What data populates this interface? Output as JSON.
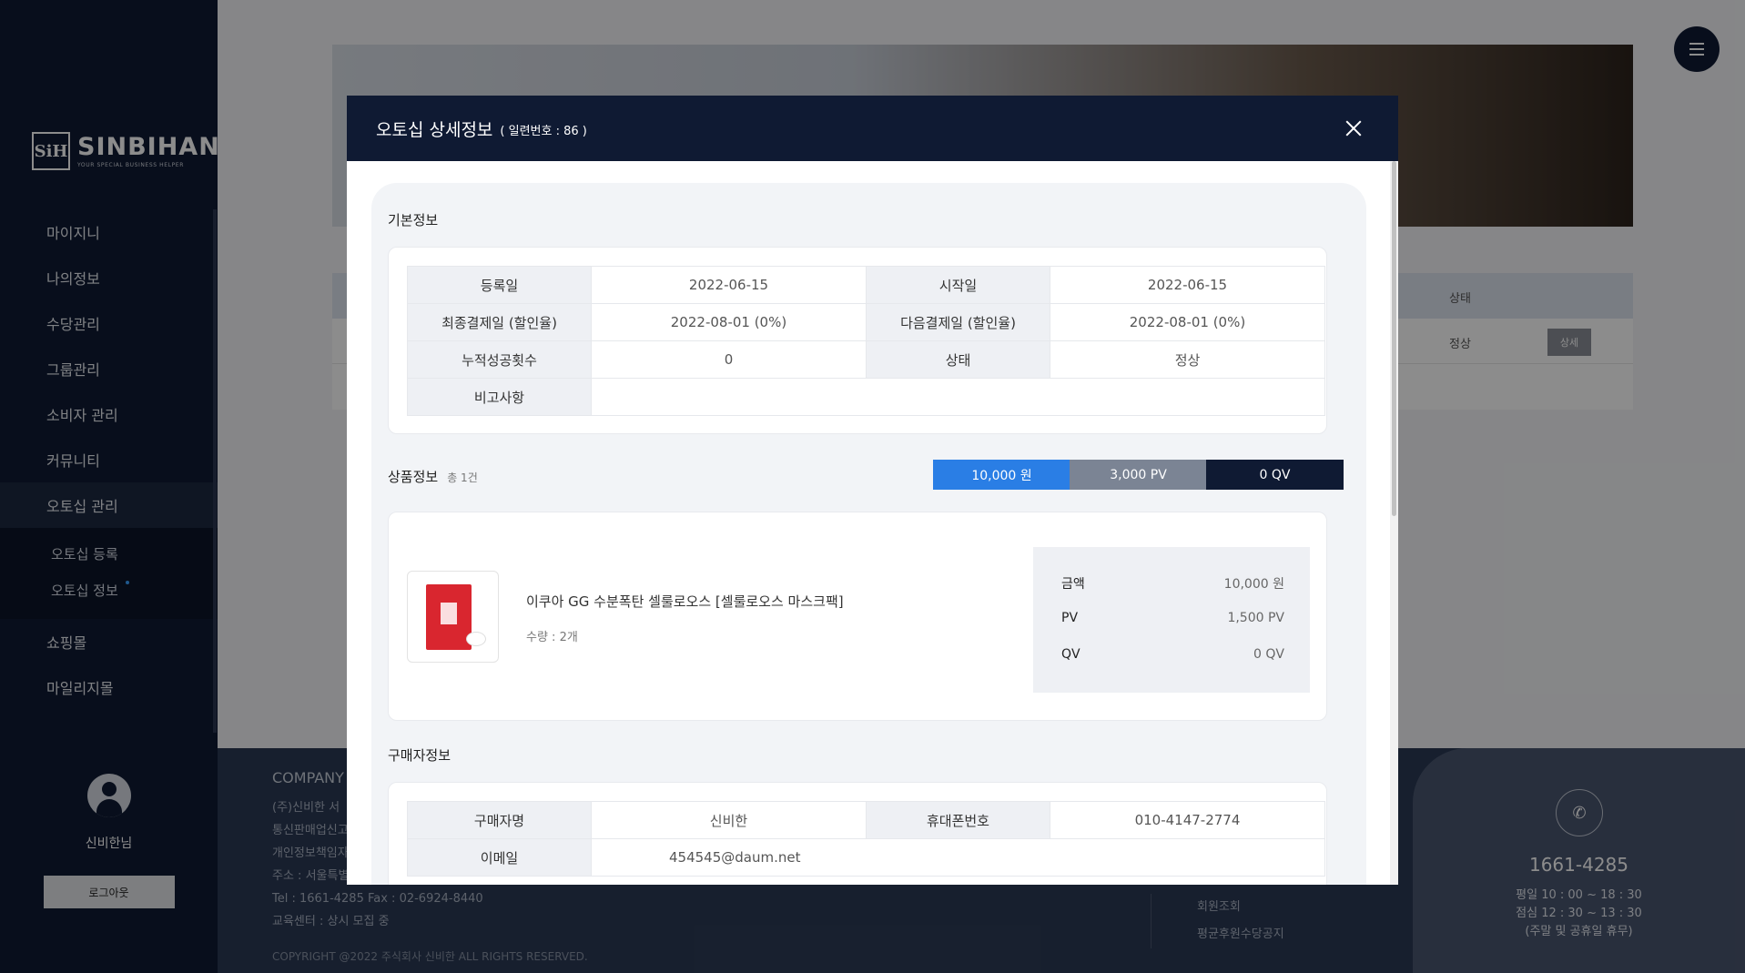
{
  "sidebar": {
    "logo_mark": "SiH",
    "logo_name": "SINBIHAN",
    "logo_tagline": "YOUR SPECIAL BUSINESS HELPER",
    "menu": [
      "마이지니",
      "나의정보",
      "수당관리",
      "그룹관리",
      "소비자 관리",
      "커뮤니티",
      "오토십 관리"
    ],
    "submenu": [
      "오토십 등록",
      "오토십 정보"
    ],
    "menu_after": [
      "쇼핑몰",
      "마일리지몰"
    ],
    "username": "신비한님",
    "logout": "로그아웃"
  },
  "background": {
    "table_header_status": "상태",
    "row_status": "정상",
    "row_button": "상세"
  },
  "footer": {
    "company_title": "COMPANY I",
    "lines": [
      "(주)신비한   서",
      "통신판매업신고",
      "개인정보책임자",
      "주소 : 서울특별",
      "Tel : 1661-4285    Fax : 02-6924-8440",
      "교육센터 : 상시 모집 중"
    ],
    "copyright": "COPYRIGHT @2022 주식회사 신비한 ALL RIGHTS RESERVED.",
    "links": [
      "회원조회",
      "평균후원수당공지"
    ],
    "phone": "1661-4285",
    "hours": [
      "평일 10 : 00 ~ 18 : 30",
      "점심 12 : 30 ~ 13 : 30",
      "(주말 및 공휴일 휴무)"
    ]
  },
  "modal": {
    "title": "오토십 상세정보",
    "serial": "( 일련번호 : 86 )",
    "basic": {
      "title": "기본정보",
      "rows": [
        [
          {
            "label": "등록일",
            "value": "2022-06-15"
          },
          {
            "label": "시작일",
            "value": "2022-06-15"
          }
        ],
        [
          {
            "label": "최종결제일 (할인율)",
            "value": "2022-08-01 (0%)"
          },
          {
            "label": "다음결제일 (할인율)",
            "value": "2022-08-01 (0%)"
          }
        ],
        [
          {
            "label": "누적성공횟수",
            "value": "0"
          },
          {
            "label": "상태",
            "value": "정상"
          }
        ]
      ],
      "note_label": "비고사항",
      "note_value": ""
    },
    "product": {
      "title": "상품정보",
      "count": "총 1건",
      "total_krw": "10,000 원",
      "total_pv": "3,000 PV",
      "total_qv": "0 QV",
      "name": "이쿠아 GG 수분폭탄 셀룰로오스 [셀룰로오스 마스크팩]",
      "qty": "수량 : 2개",
      "price_rows": [
        {
          "k": "금액",
          "v": "10,000 원"
        },
        {
          "k": "PV",
          "v": "1,500 PV"
        },
        {
          "k": "QV",
          "v": "0 QV"
        }
      ]
    },
    "buyer": {
      "title": "구매자정보",
      "name_label": "구매자명",
      "name_value": "신비한",
      "phone_label": "휴대폰번호",
      "phone_value": "010-4147-2774",
      "email_label": "이메일",
      "email_value": "454545@daum.net"
    }
  }
}
